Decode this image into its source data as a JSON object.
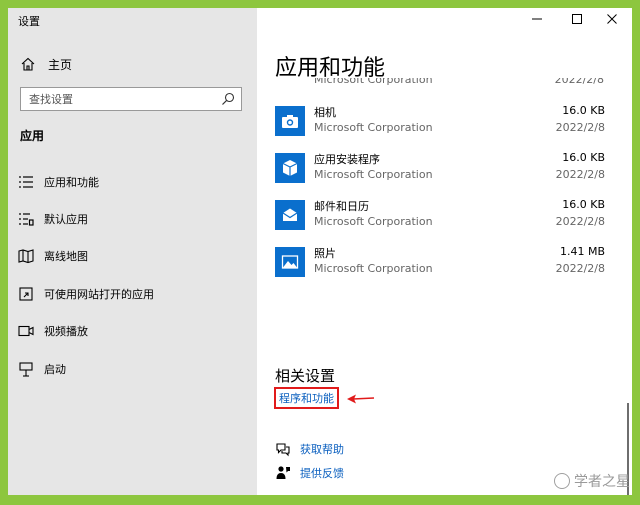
{
  "window": {
    "title": "设置"
  },
  "nav": {
    "home_label": "主页",
    "search_placeholder": "查找设置",
    "section_label": "应用",
    "items": [
      {
        "label": "应用和功能",
        "icon": "apps-list-icon"
      },
      {
        "label": "默认应用",
        "icon": "default-apps-icon"
      },
      {
        "label": "离线地图",
        "icon": "offline-maps-icon"
      },
      {
        "label": "可使用网站打开的应用",
        "icon": "apps-for-websites-icon"
      },
      {
        "label": "视频播放",
        "icon": "video-playback-icon"
      },
      {
        "label": "启动",
        "icon": "startup-icon"
      }
    ]
  },
  "main": {
    "title": "应用和功能",
    "clipped_row": {
      "publisher": "Microsoft Corporation",
      "date": "2022/2/8"
    },
    "apps": [
      {
        "name": "相机",
        "publisher": "Microsoft Corporation",
        "size": "16.0 KB",
        "date": "2022/2/8",
        "icon": "camera-icon"
      },
      {
        "name": "应用安装程序",
        "publisher": "Microsoft Corporation",
        "size": "16.0 KB",
        "date": "2022/2/8",
        "icon": "app-installer-icon"
      },
      {
        "name": "邮件和日历",
        "publisher": "Microsoft Corporation",
        "size": "16.0 KB",
        "date": "2022/2/8",
        "icon": "mail-icon"
      },
      {
        "name": "照片",
        "publisher": "Microsoft Corporation",
        "size": "1.41 MB",
        "date": "2022/2/8",
        "icon": "photos-icon"
      }
    ],
    "related_title": "相关设置",
    "programs_link": "程序和功能",
    "help_label": "获取帮助",
    "feedback_label": "提供反馈"
  },
  "watermark": {
    "text": "学者之星"
  },
  "colors": {
    "accent": "#0a6fcd",
    "link": "#0a5fbf",
    "highlight": "#e11b1b",
    "background": "#8dc63f"
  }
}
